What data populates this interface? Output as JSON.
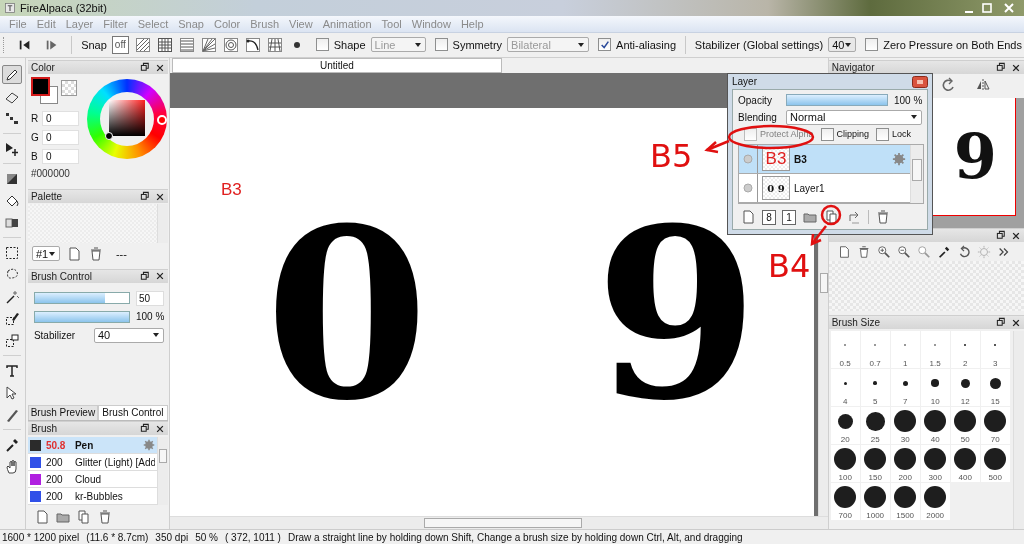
{
  "window": {
    "title": "FireAlpaca (32bit)"
  },
  "menu": [
    "File",
    "Edit",
    "Layer",
    "Filter",
    "Select",
    "Snap",
    "Color",
    "Brush",
    "View",
    "Animation",
    "Tool",
    "Window",
    "Help"
  ],
  "toolbar": {
    "snap": {
      "label": "Snap",
      "modes": [
        {
          "label": "off",
          "selected": true
        },
        {
          "selected": false
        },
        {
          "selected": false
        },
        {
          "selected": false
        },
        {
          "selected": false
        },
        {
          "selected": false
        },
        {
          "selected": false
        },
        {
          "selected": false
        },
        {
          "selected": false
        }
      ]
    },
    "shape": {
      "label": "Shape",
      "checked": false,
      "value": "Line"
    },
    "symmetry": {
      "label": "Symmetry",
      "checked": false,
      "value": "Bilateral"
    },
    "anti_aliasing": {
      "label": "Anti-aliasing",
      "checked": true
    },
    "stabilizer": {
      "label": "Stabilizer (Global settings)",
      "value": "40"
    },
    "zero_pressure": {
      "label": "Zero Pressure on Both Ends",
      "checked": false
    }
  },
  "tools": [
    {
      "selected": true
    },
    {
      "selected": false
    },
    {
      "selected": false
    },
    {
      "selected": false
    },
    {
      "selected": false
    },
    {
      "selected": false
    },
    {
      "selected": false
    },
    {
      "selected": false
    },
    {
      "selected": false
    },
    {
      "selected": false
    },
    {
      "selected": false
    },
    {
      "selected": false
    },
    {
      "selected": false
    },
    {
      "selected": false
    },
    {
      "selected": false
    },
    {
      "selected": false
    },
    {
      "selected": false
    }
  ],
  "color_panel": {
    "title": "Color",
    "fields": [
      {
        "label": "R",
        "value": "0"
      },
      {
        "label": "G",
        "value": "0"
      },
      {
        "label": "B",
        "value": "0"
      }
    ],
    "hex": "#000000"
  },
  "palette": {
    "title": "Palette",
    "set": "#1",
    "note": "---"
  },
  "brush_control": {
    "title": "Brush Control",
    "size": {
      "level": 0.75,
      "value": "50"
    },
    "opacity": {
      "level": 1,
      "value": "100 %"
    },
    "stabilizer": {
      "label": "Stabilizer",
      "value": "40"
    }
  },
  "left_tabs": [
    {
      "label": "Brush Preview",
      "selected": false
    },
    {
      "label": "Brush Control",
      "selected": true
    }
  ],
  "brush_panel": {
    "title": "Brush",
    "brushes": [
      {
        "size": "50.8",
        "name": "Pen",
        "color": "#2b2b2b",
        "selected": true
      },
      {
        "size": "200",
        "name": "Glitter (Light) [Add",
        "color": "#3050e8",
        "selected": false
      },
      {
        "size": "200",
        "name": "Cloud",
        "color": "#b020e0",
        "selected": false
      },
      {
        "size": "200",
        "name": "kr-Bubbles",
        "color": "#3050e8",
        "selected": false
      }
    ]
  },
  "document": {
    "tab": "Untitled",
    "layer_text": "B3",
    "digits": [
      "0",
      "9"
    ]
  },
  "navigator": {
    "title": "Navigator",
    "preview": "9"
  },
  "brush_size": {
    "title": "Brush Size",
    "sizes": [
      "0.5",
      "0.7",
      "1",
      "1.5",
      "2",
      "3",
      "4",
      "5",
      "7",
      "10",
      "12",
      "15",
      "20",
      "25",
      "30",
      "40",
      "50",
      "70",
      "100",
      "150",
      "200",
      "300",
      "400",
      "500",
      "700",
      "1000",
      "1500",
      "2000"
    ]
  },
  "layer_window": {
    "title": "Layer",
    "opacity": {
      "label": "Opacity",
      "level": 1,
      "value": "100 %"
    },
    "blending": {
      "label": "Blending",
      "value": "Normal"
    },
    "options": [
      {
        "label": "Protect Alpha",
        "checked": false,
        "disabled": true
      },
      {
        "label": "Clipping",
        "checked": false,
        "disabled": false
      },
      {
        "label": "Lock",
        "checked": false,
        "disabled": false
      }
    ],
    "layers": [
      {
        "name": "B3",
        "thumbnail": "B3",
        "selected": true
      },
      {
        "name": "Layer1",
        "thumbnail": "0 9",
        "selected": false
      }
    ],
    "bit_buttons": [
      "8",
      "1"
    ]
  },
  "annotations": [
    "B5",
    "B4"
  ],
  "status_bar": [
    "1600 * 1200 pixel",
    "(11.6 * 8.7cm)",
    "350 dpi",
    "50 %",
    "( 372, 1011 )",
    "Draw a straight line by holding down Shift, Change a brush size by holding down Ctrl, Alt, and dragging"
  ]
}
